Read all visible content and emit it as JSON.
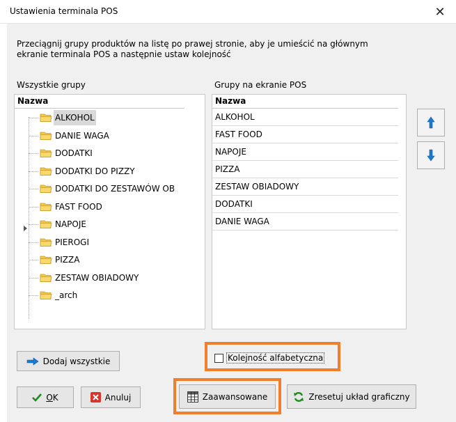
{
  "window": {
    "title": "Ustawienia terminala POS",
    "close_glyph": "✕"
  },
  "intro": {
    "line1": "Przeciągnij grupy produktów na listę po prawej stronie, aby je umieścić na głównym",
    "line2": "ekranie terminala POS a następnie ustaw kolejność"
  },
  "all_groups": {
    "label": "Wszystkie grupy",
    "header": "Nazwa",
    "items": [
      "ALKOHOL",
      "DANIE WAGA",
      "DODATKI",
      "DODATKI DO PIZZY",
      "DODATKI DO ZESTAWÓW OB",
      "FAST FOOD",
      "NAPOJE",
      "PIEROGI",
      "PIZZA",
      "ZESTAW OBIADOWY",
      "_arch"
    ],
    "selected": "ALKOHOL",
    "expandable": "NAPOJE"
  },
  "pos_groups": {
    "label": "Grupy na ekranie POS",
    "header": "Nazwa",
    "items": [
      "ALKOHOL",
      "FAST FOOD",
      "NAPOJE",
      "PIZZA",
      "ZESTAW OBIADOWY",
      "DODATKI",
      "DANIE WAGA"
    ]
  },
  "buttons": {
    "move_up_icon": "arrow-up-icon",
    "move_down_icon": "arrow-down-icon",
    "add_all": "Dodaj wszystkie",
    "alphabetical": "Kolejność alfabetyczna",
    "ok_underlined": "O",
    "ok_rest": "K",
    "cancel": "Anuluj",
    "advanced": "Zaawansowane",
    "reset_layout": "Zresetuj układ graficzny"
  },
  "alphabetical_checked": false,
  "colors": {
    "highlight": "#f07e2a",
    "folder": "#f5c64a",
    "arrow_blue": "#1a7ad0",
    "check_green": "#1e8a1e",
    "cancel_red": "#d9332b"
  }
}
